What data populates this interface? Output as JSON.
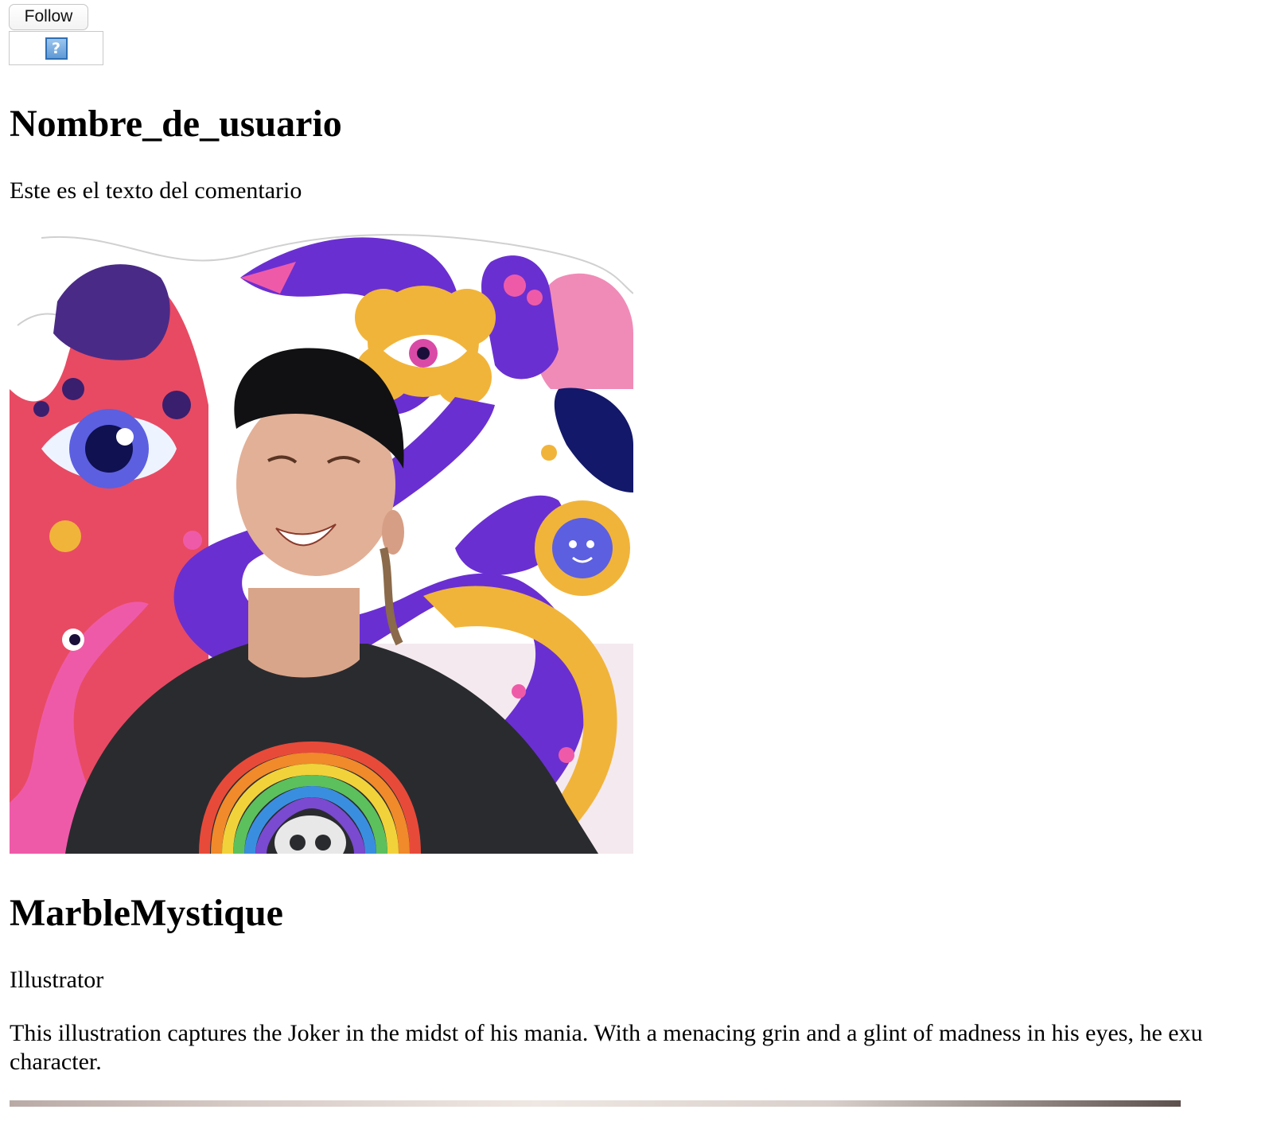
{
  "follow_button": {
    "label": "Follow"
  },
  "broken_image": {
    "glyph": "?"
  },
  "comment": {
    "username": "Nombre_de_usuario",
    "text": "Este es el texto del comentario"
  },
  "artist": {
    "name": "MarbleMystique",
    "role": "Illustrator",
    "description": "This illustration captures the Joker in the midst of his mania. With a menacing grin and a glint of madness in his eyes, he exu character."
  },
  "colors": {
    "purple": "#6a2fd1",
    "pink": "#ef5aa8",
    "yellow": "#f1b43a",
    "red": "#e84a63",
    "navy": "#13186a"
  }
}
